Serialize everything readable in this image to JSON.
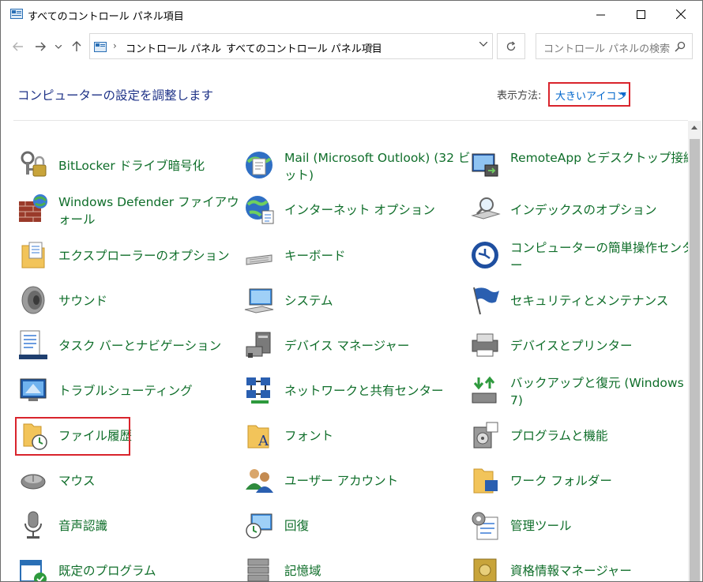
{
  "window": {
    "title": "すべてのコントロール パネル項目"
  },
  "address": {
    "crumbs": [
      "コントロール パネル",
      "すべてのコントロール パネル項目"
    ]
  },
  "search": {
    "placeholder": "コントロール パネルの検索"
  },
  "header": {
    "title": "コンピューターの設定を調整します",
    "view_by_label": "表示方法:",
    "view_by_value": "大きいアイコン"
  },
  "items": {
    "c1": [
      "BitLocker ドライブ暗号化",
      "Windows Defender ファイアウォール",
      "エクスプローラーのオプション",
      "サウンド",
      "タスク バーとナビゲーション",
      "トラブルシューティング",
      "ファイル履歴",
      "マウス",
      "音声認識",
      "既定のプログラム"
    ],
    "c2": [
      "Mail (Microsoft Outlook) (32 ビット)",
      "インターネット オプション",
      "キーボード",
      "システム",
      "デバイス マネージャー",
      "ネットワークと共有センター",
      "フォント",
      "ユーザー アカウント",
      "回復",
      "記憶域"
    ],
    "c3": [
      "RemoteApp とデスクトップ接続",
      "インデックスのオプション",
      "コンピューターの簡単操作センター",
      "セキュリティとメンテナンス",
      "デバイスとプリンター",
      "バックアップと復元 (Windows 7)",
      "プログラムと機能",
      "ワーク フォルダー",
      "管理ツール",
      "資格情報マネージャー"
    ]
  },
  "colors": {
    "link": "#0f6e2a",
    "header_link": "#1e3287",
    "highlight": "#d9242c",
    "accent": "#0066cc"
  }
}
